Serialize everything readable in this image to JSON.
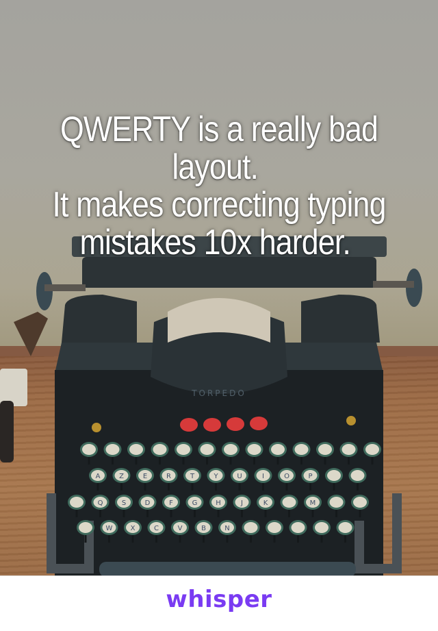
{
  "post": {
    "message": "QWERTY is a really bad layout. \nIt makes correcting typing mistakes 10x harder. ",
    "background_image": "vintage-typewriter-photo",
    "typewriter_brand_text": "TORPEDO",
    "keyboard_rows": [
      [
        "",
        "",
        "",
        "",
        "",
        "",
        "",
        "",
        "",
        "",
        "",
        "",
        ""
      ],
      [
        "A",
        "Z",
        "E",
        "R",
        "T",
        "Y",
        "U",
        "I",
        "O",
        "P",
        "",
        ""
      ],
      [
        "",
        "Q",
        "S",
        "D",
        "F",
        "G",
        "H",
        "J",
        "K",
        "",
        "M",
        "",
        ""
      ],
      [
        "",
        "W",
        "X",
        "C",
        "V",
        "B",
        "N",
        "",
        "",
        "",
        "",
        ""
      ]
    ]
  },
  "footer": {
    "brand": "whisper",
    "brand_color": "#7a3bf2"
  }
}
